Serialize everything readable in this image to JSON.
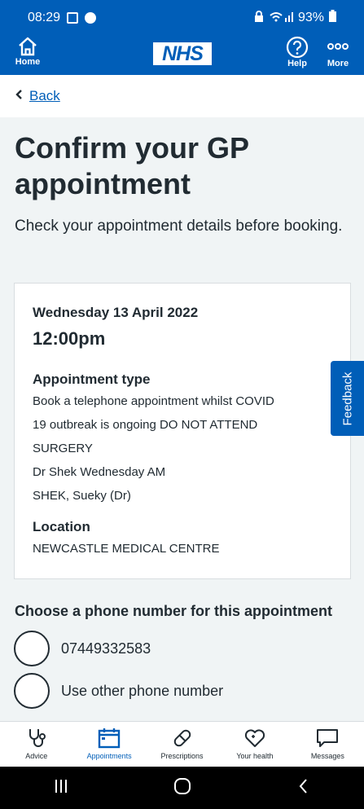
{
  "status_bar": {
    "time": "08:29",
    "battery": "93%"
  },
  "header": {
    "home_label": "Home",
    "logo_text": "NHS",
    "help_label": "Help",
    "more_label": "More"
  },
  "back": {
    "label": "Back"
  },
  "page": {
    "title": "Confirm your GP appointment",
    "lead": "Check your appointment details before booking."
  },
  "appointment": {
    "date": "Wednesday 13 April 2022",
    "time": "12:00pm",
    "type_heading": "Appointment type",
    "type_lines": [
      "Book a telephone appointment whilst COVID",
      "19 outbreak is ongoing DO NOT ATTEND",
      "SURGERY",
      "Dr Shek Wednesday AM",
      "SHEK, Sueky (Dr)"
    ],
    "location_heading": "Location",
    "location": "NEWCASTLE MEDICAL CENTRE"
  },
  "feedback": {
    "label": "Feedback"
  },
  "phone": {
    "question": "Choose a phone number for this appointment",
    "options": [
      "07449332583",
      "Use other phone number"
    ]
  },
  "bottom_nav": {
    "items": [
      {
        "label": "Advice",
        "icon": "stethoscope-icon"
      },
      {
        "label": "Appointments",
        "icon": "calendar-icon"
      },
      {
        "label": "Prescriptions",
        "icon": "pill-icon"
      },
      {
        "label": "Your health",
        "icon": "heart-icon"
      },
      {
        "label": "Messages",
        "icon": "message-icon"
      }
    ],
    "active_index": 1
  },
  "colors": {
    "brand": "#005eb8",
    "background": "#f0f4f5",
    "text": "#212b32"
  }
}
